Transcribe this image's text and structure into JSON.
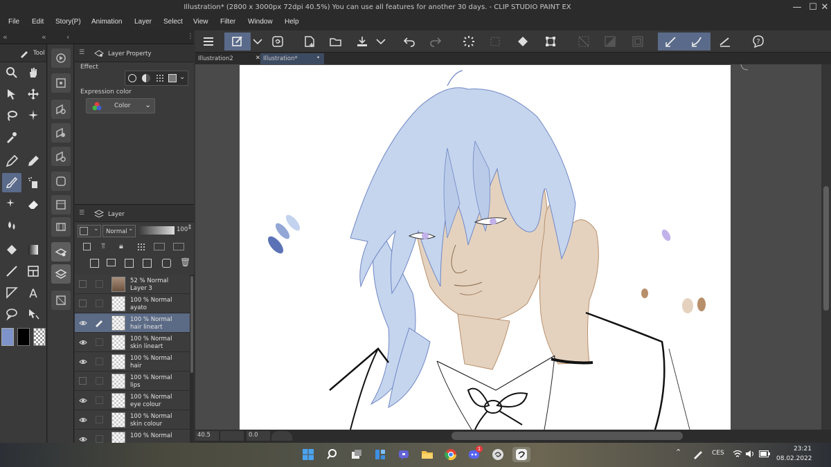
{
  "window": {
    "title": "Illustration* (2800 x 3000px 72dpi 40.5%)  You can use all features for another 30 days. - CLIP STUDIO PAINT EX",
    "minimize": "—",
    "maximize": "☐",
    "close": "✕"
  },
  "menu": [
    "File",
    "Edit",
    "Story(P)",
    "Animation",
    "Layer",
    "Select",
    "View",
    "Filter",
    "Window",
    "Help"
  ],
  "tool_panel": {
    "tab_label": "Tool"
  },
  "layer_property": {
    "tab_label": "Layer Property",
    "effect_label": "Effect",
    "expression_color_label": "Expression color",
    "color_button": "Color"
  },
  "layer_panel": {
    "tab_label": "Layer",
    "blend_mode": "Normal",
    "opacity": "100",
    "layers": [
      {
        "pct": "52 % Normal",
        "name": "Layer 3",
        "visible": false,
        "selected": false,
        "photo": true
      },
      {
        "pct": "100 % Normal",
        "name": "ayato",
        "visible": false,
        "selected": false
      },
      {
        "pct": "100 % Normal",
        "name": "hair lineart",
        "visible": true,
        "selected": true
      },
      {
        "pct": "100 % Normal",
        "name": "skin lineart",
        "visible": true,
        "selected": false
      },
      {
        "pct": "100 % Normal",
        "name": "hair",
        "visible": true,
        "selected": false
      },
      {
        "pct": "100 % Normal",
        "name": "lips",
        "visible": false,
        "selected": false
      },
      {
        "pct": "100 % Normal",
        "name": "eye colour",
        "visible": true,
        "selected": false
      },
      {
        "pct": "100 % Normal",
        "name": "skin colour",
        "visible": true,
        "selected": false
      },
      {
        "pct": "100 % Normal",
        "name": "",
        "visible": true,
        "selected": false
      }
    ]
  },
  "doc_tabs": [
    {
      "label": "Illustration2",
      "close": "✕",
      "active": false
    },
    {
      "label": "Illustration*",
      "close": "•",
      "active": true
    }
  ],
  "status": {
    "zoom": "40.5",
    "angle": "0.0"
  },
  "colors": {
    "accent": "#5a6a8a",
    "main_color": "#7d93c9",
    "hair_color": "#c5d5ee",
    "skin_color": "#e4d2bf"
  },
  "taskbar": {
    "language": "CES",
    "time": "23:21",
    "date": "08.02.2022",
    "discord_badge": "1"
  }
}
